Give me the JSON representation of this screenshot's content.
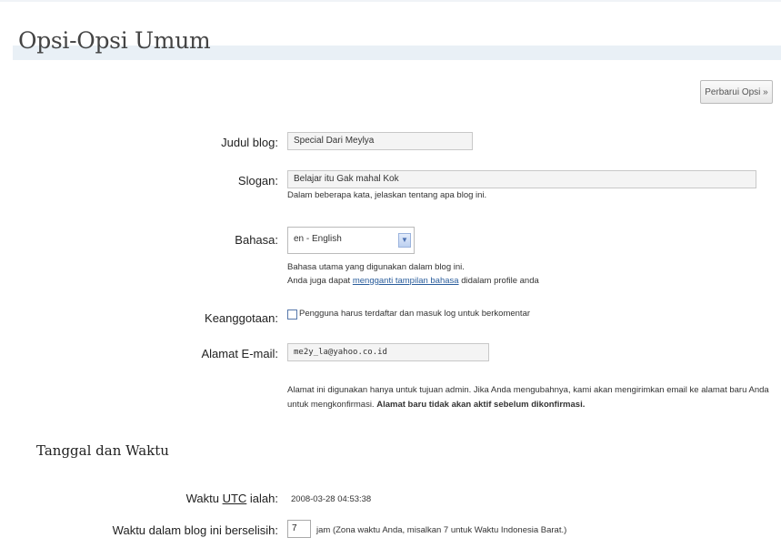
{
  "header": {
    "title": "Opsi-Opsi Umum",
    "update_button": "Perbarui Opsi »"
  },
  "general": {
    "blog_title": {
      "label": "Judul blog:",
      "value": "Special Dari Meylya"
    },
    "tagline": {
      "label": "Slogan:",
      "value": "Belajar itu Gak mahal Kok",
      "help": "Dalam beberapa kata, jelaskan tentang apa blog ini."
    },
    "language": {
      "label": "Bahasa:",
      "selected": "en - English",
      "help_line1": "Bahasa utama yang digunakan dalam blog ini.",
      "help_line2_pre": "Anda juga dapat ",
      "help_link": "mengganti tampilan bahasa",
      "help_line2_post": " didalam profile anda"
    },
    "membership": {
      "label": "Keanggotaan:",
      "checkbox_label": "Pengguna harus terdaftar dan masuk log untuk berkomentar",
      "checked": false
    },
    "email": {
      "label": "Alamat E-mail:",
      "value": "me2y_la@yahoo.co.id",
      "help_line1": "Alamat ini digunakan hanya untuk tujuan admin. Jika Anda mengubahnya, kami akan mengirimkan email ke alamat baru Anda",
      "help_line2_pre": "untuk mengkonfirmasi. ",
      "help_line2_bold": "Alamat baru tidak akan aktif sebelum dikonfirmasi."
    }
  },
  "datetime": {
    "section_title": "Tanggal dan Waktu",
    "utc": {
      "label_pre": "Waktu ",
      "label_abbr": "UTC",
      "label_post": " ialah:",
      "value": "2008-03-28 04:53:38"
    },
    "offset": {
      "label": "Waktu dalam blog ini berselisih:",
      "value": "7",
      "help": "jam (Zona waktu Anda, misalkan 7 untuk Waktu Indonesia Barat.)"
    }
  }
}
